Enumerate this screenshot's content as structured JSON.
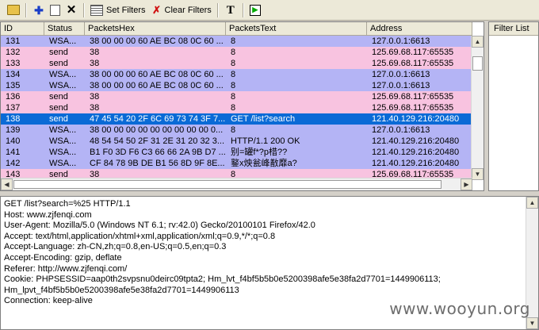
{
  "toolbar": {
    "set_filters_label": "Set Filters",
    "clear_filters_label": "Clear Filters",
    "text_button_label": "T",
    "play_button_label": "▶"
  },
  "packet_list": {
    "columns": [
      "ID",
      "Status",
      "PacketsHex",
      "PacketsText",
      "Address"
    ],
    "rows": [
      {
        "id": "131",
        "status": "WSA...",
        "hex": "38 00 00 00 60 AE BC 08 0C 60 ...",
        "text": "8",
        "address": "127.0.0.1:6613",
        "style": "blue"
      },
      {
        "id": "132",
        "status": "send",
        "hex": "38",
        "text": "8",
        "address": "125.69.68.117:65535",
        "style": "pink"
      },
      {
        "id": "133",
        "status": "send",
        "hex": "38",
        "text": "8",
        "address": "125.69.68.117:65535",
        "style": "pink"
      },
      {
        "id": "134",
        "status": "WSA...",
        "hex": "38 00 00 00 60 AE BC 08 0C 60 ...",
        "text": "8",
        "address": "127.0.0.1:6613",
        "style": "blue"
      },
      {
        "id": "135",
        "status": "WSA...",
        "hex": "38 00 00 00 60 AE BC 08 0C 60 ...",
        "text": "8",
        "address": "127.0.0.1:6613",
        "style": "blue"
      },
      {
        "id": "136",
        "status": "send",
        "hex": "38",
        "text": "8",
        "address": "125.69.68.117:65535",
        "style": "pink"
      },
      {
        "id": "137",
        "status": "send",
        "hex": "38",
        "text": "8",
        "address": "125.69.68.117:65535",
        "style": "pink"
      },
      {
        "id": "138",
        "status": "send",
        "hex": "47 45 54 20 2F 6C 69 73 74 3F 7...",
        "text": "GET /list?search",
        "address": "121.40.129.216:20480",
        "style": "sel"
      },
      {
        "id": "139",
        "status": "WSA...",
        "hex": "38 00 00 00 00 00 00 00 00 00 0...",
        "text": "8",
        "address": "127.0.0.1:6613",
        "style": "blue"
      },
      {
        "id": "140",
        "status": "WSA...",
        "hex": "48 54 54 50 2F 31 2E 31 20 32 3...",
        "text": "HTTP/1.1 200 OK",
        "address": "121.40.129.216:20480",
        "style": "blue"
      },
      {
        "id": "141",
        "status": "WSA...",
        "hex": "B1 F0 3D F6 C3 66 66 2A 9B D7 ...",
        "text": "别=罐f*?p棤??",
        "address": "121.40.129.216:20480",
        "style": "blue"
      },
      {
        "id": "142",
        "status": "WSA...",
        "hex": "CF 84 78 9B DE B1 56 8D 9F 8E...",
        "text": "鐜x炴瓮峰敾靡a?",
        "address": "121.40.129.216:20480",
        "style": "blue"
      },
      {
        "id": "143",
        "status": "send",
        "hex": "38",
        "text": "8",
        "address": "125.69.68.117:65535",
        "style": "pink"
      }
    ]
  },
  "filter_list": {
    "header": "Filter List"
  },
  "details": {
    "lines": [
      "GET /list?search=%25 HTTP/1.1",
      "Host: www.zjfenqi.com",
      "User-Agent: Mozilla/5.0 (Windows NT 6.1; rv:42.0) Gecko/20100101 Firefox/42.0",
      "Accept: text/html,application/xhtml+xml,application/xml;q=0.9,*/*;q=0.8",
      "Accept-Language: zh-CN,zh;q=0.8,en-US;q=0.5,en;q=0.3",
      "Accept-Encoding: gzip, deflate",
      "Referer: http://www.zjfenqi.com/",
      "Cookie: PHPSESSID=aap0th2svpsnu0deirc09tpta2; Hm_lvt_f4bf5b5b0e5200398afe5e38fa2d7701=1449906113;",
      "Hm_lpvt_f4bf5b5b0e5200398afe5e38fa2d7701=1449906113",
      "Connection: keep-alive"
    ]
  },
  "watermark": "www.wooyun.org"
}
